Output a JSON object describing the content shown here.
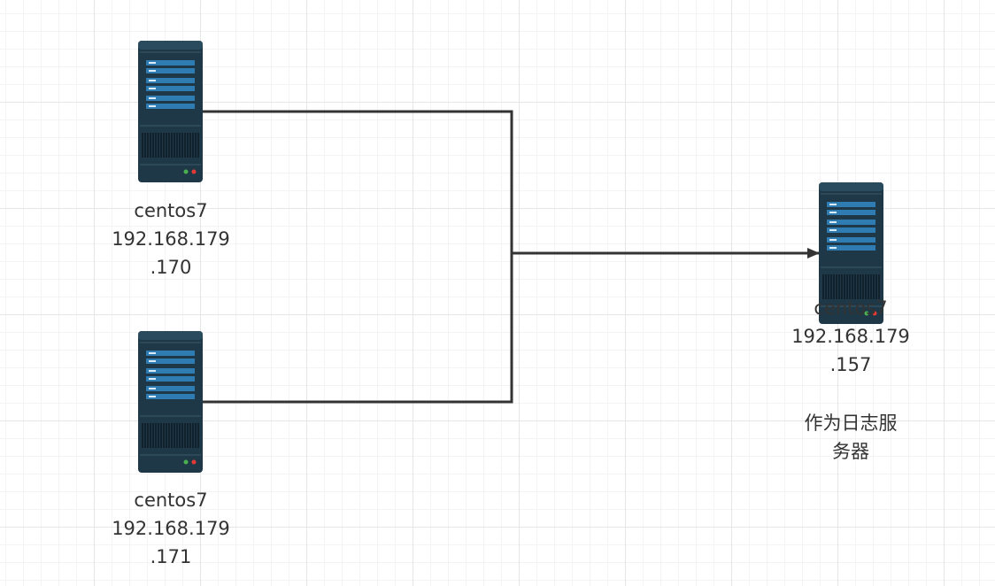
{
  "servers": [
    {
      "id": "client-1",
      "line1": "centos7",
      "line2": "192.168.179",
      "line3": ".170"
    },
    {
      "id": "client-2",
      "line1": "centos7",
      "line2": "192.168.179",
      "line3": ".171"
    },
    {
      "id": "log-server",
      "line1": "centos7",
      "line2": "192.168.179",
      "line3": ".157",
      "note1": "作为日志服",
      "note2": "务器"
    }
  ],
  "colors": {
    "server_body": "#1f3847",
    "server_panel": "#2f7cb3",
    "connector": "#333333",
    "led_green": "#4caf50",
    "led_red": "#e53935"
  },
  "icons": [
    "server-icon"
  ]
}
